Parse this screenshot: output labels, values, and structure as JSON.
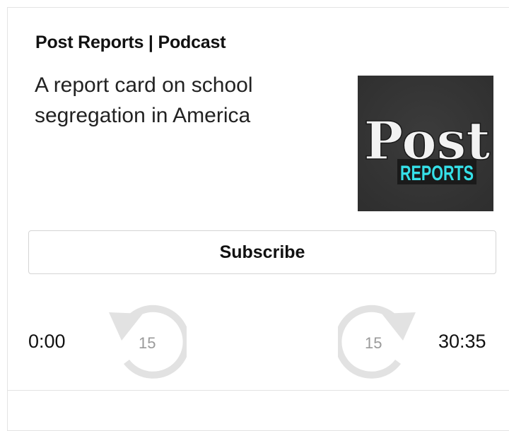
{
  "podcast": {
    "label": "Post Reports | Podcast",
    "episode_title": "A report card on school segregation in America",
    "artwork": {
      "logo_word": "Post",
      "logo_subword": "REPORTS",
      "background_color": "#2f2f2f",
      "accent_color": "#35e0e8"
    }
  },
  "subscribe": {
    "label": "Subscribe"
  },
  "player": {
    "current_time": "0:00",
    "total_time": "30:35",
    "skip_back_seconds": "15",
    "skip_forward_seconds": "15",
    "icon_color": "#e2e2e2"
  }
}
